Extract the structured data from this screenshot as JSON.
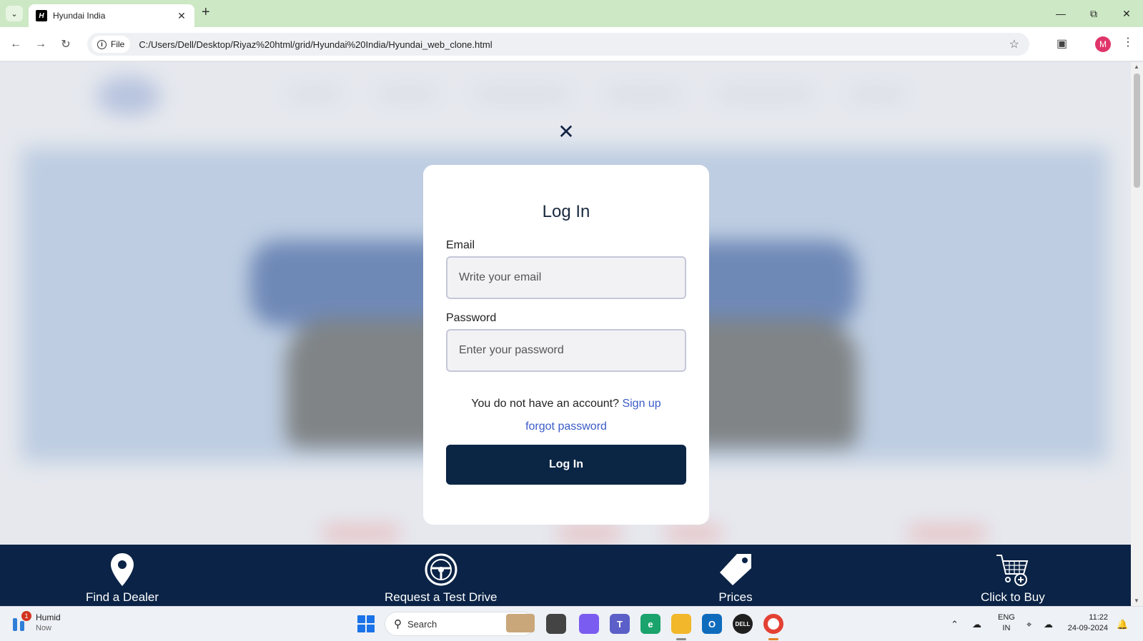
{
  "browser": {
    "tab_title": "Hyundai India",
    "url_scheme_chip": "File",
    "url": "C:/Users/Dell/Desktop/Riyaz%20html/grid/Hyundai%20India/Hyundai_web_clone.html",
    "profile_initial": "M"
  },
  "login_modal": {
    "title": "Log In",
    "email_label": "Email",
    "email_placeholder": "Write your email",
    "password_label": "Password",
    "password_placeholder": "Enter your password",
    "no_account_text": "You do not have an account?",
    "signup_link": "Sign up",
    "forgot_link": "forgot password",
    "submit_label": "Log In"
  },
  "bottom_bar": {
    "items": [
      {
        "label": "Find a Dealer",
        "icon": "location-pin-icon"
      },
      {
        "label": "Request a Test Drive",
        "icon": "steering-wheel-icon"
      },
      {
        "label": "Prices",
        "icon": "price-tag-icon"
      },
      {
        "label": "Click to Buy",
        "icon": "shopping-cart-icon"
      }
    ]
  },
  "taskbar": {
    "weather_title": "Humid",
    "weather_sub": "Now",
    "weather_badge": "1",
    "search_placeholder": "Search",
    "lang_top": "ENG",
    "lang_bottom": "IN",
    "time": "11:22",
    "date": "24-09-2024"
  },
  "colors": {
    "brand_navy": "#0a2346",
    "button_navy": "#0b2545",
    "link_blue": "#3a5bc7",
    "tab_strip": "#cde8c5"
  }
}
